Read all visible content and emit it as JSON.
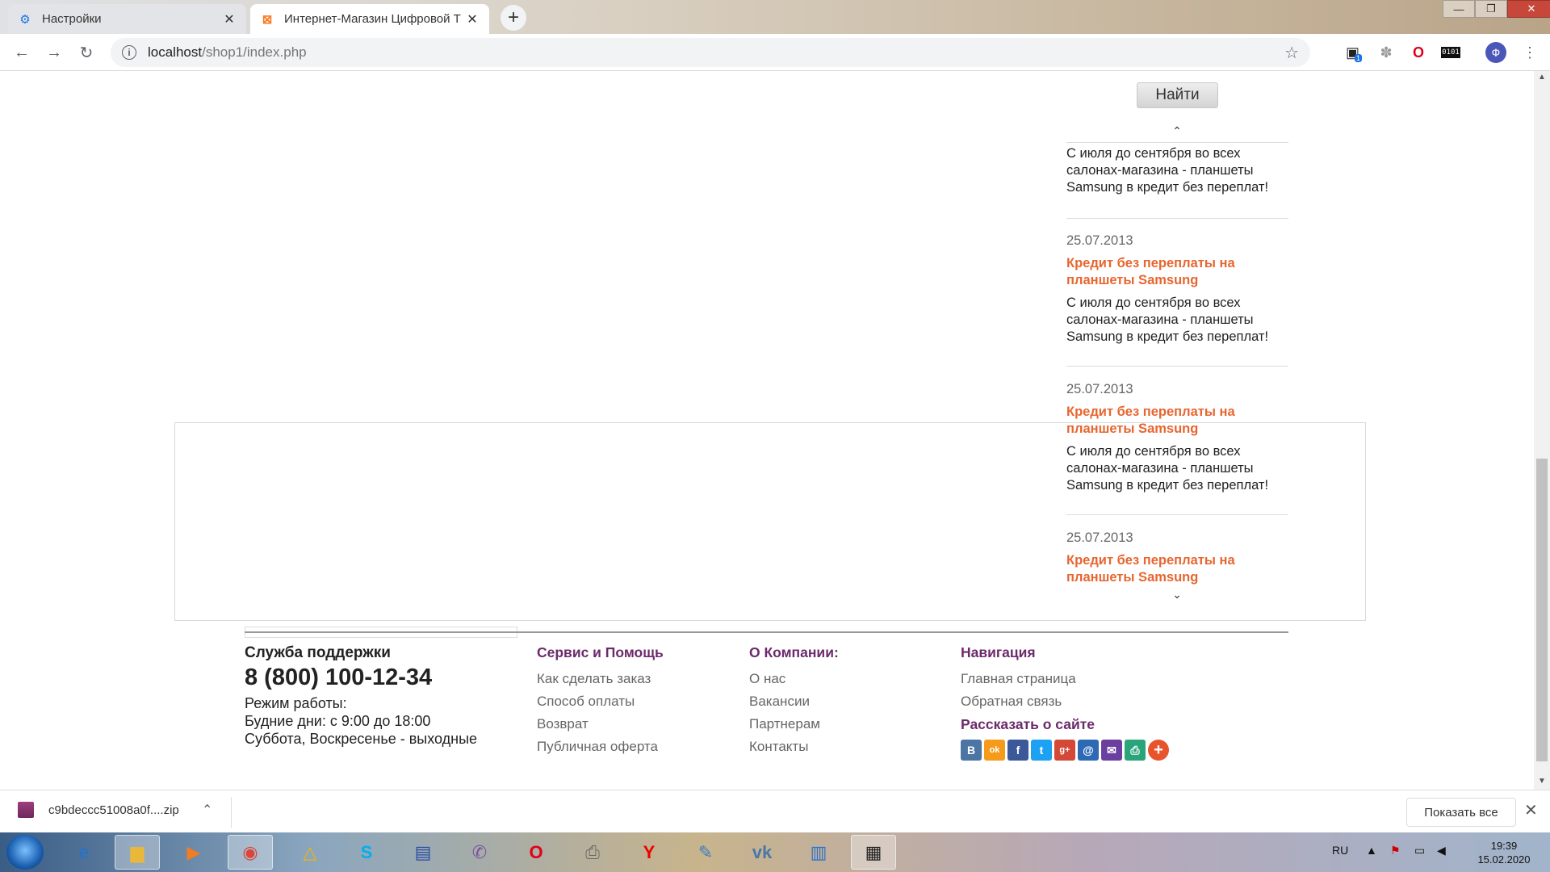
{
  "browser": {
    "tabs": [
      {
        "label": "Настройки",
        "icon": "gear-icon",
        "active": false
      },
      {
        "label": "Интернет-Магазин Цифровой Т",
        "icon": "xampp-icon",
        "active": true
      }
    ],
    "url_host": "localhost",
    "url_path": "/shop1/index.php",
    "profile_initial": "Ф",
    "ext_badge": "1",
    "ext_binary": "0101"
  },
  "search": {
    "button_label": "Найти"
  },
  "news": [
    {
      "date": "",
      "title": "",
      "desc": "С июля до сентября во всех салонах-магазина - планшеты Samsung в кредит без переплат!"
    },
    {
      "date": "25.07.2013",
      "title": "Кредит без переплаты на планшеты Samsung",
      "desc": "С июля до сентября во всех салонах-магазина - планшеты Samsung в кредит без переплат!"
    },
    {
      "date": "25.07.2013",
      "title": "Кредит без переплаты на планшеты Samsung",
      "desc": "С июля до сентября во всех салонах-магазина - планшеты Samsung в кредит без переплат!"
    },
    {
      "date": "25.07.2013",
      "title": "Кредит без переплаты на планшеты Samsung",
      "desc": ""
    }
  ],
  "footer": {
    "support": {
      "title": "Служба поддержки",
      "phone": "8 (800) 100-12-34",
      "hours_label": "Режим работы:",
      "weekdays": "Будние дни: с 9:00 до 18:00",
      "weekend": "Суббота, Воскресенье - выходные"
    },
    "service": {
      "title": "Сервис и Помощь",
      "links": [
        "Как сделать заказ",
        "Способ оплаты",
        "Возврат",
        "Публичная оферта"
      ]
    },
    "company": {
      "title": "О Компании:",
      "links": [
        "О нас",
        "Вакансии",
        "Партнерам",
        "Контакты"
      ]
    },
    "navigation": {
      "title": "Навигация",
      "links": [
        "Главная страница",
        "Обратная связь"
      ]
    },
    "share": {
      "title": "Рассказать о сайте",
      "buttons": [
        {
          "label": "B",
          "icon": "vk-share-icon",
          "color": "#4c75a3"
        },
        {
          "label": "ok",
          "icon": "odnoklassniki-share-icon",
          "color": "#f59a1b"
        },
        {
          "label": "f",
          "icon": "facebook-share-icon",
          "color": "#3b5998"
        },
        {
          "label": "t",
          "icon": "twitter-share-icon",
          "color": "#1da1f2"
        },
        {
          "label": "g+",
          "icon": "googleplus-share-icon",
          "color": "#d34836"
        },
        {
          "label": "@",
          "icon": "mailru-share-icon",
          "color": "#2d6ab3"
        },
        {
          "label": "✉",
          "icon": "email-share-icon",
          "color": "#6b3fa0"
        },
        {
          "label": "⎙",
          "icon": "print-share-icon",
          "color": "#2aa57a"
        },
        {
          "label": "+",
          "icon": "more-share-icon",
          "color": "#e8532c"
        }
      ]
    }
  },
  "download": {
    "filename": "c9bdeccc51008a0f....zip",
    "show_all": "Показать все"
  },
  "taskbar": {
    "lang": "RU",
    "time": "19:39",
    "date": "15.02.2020"
  }
}
